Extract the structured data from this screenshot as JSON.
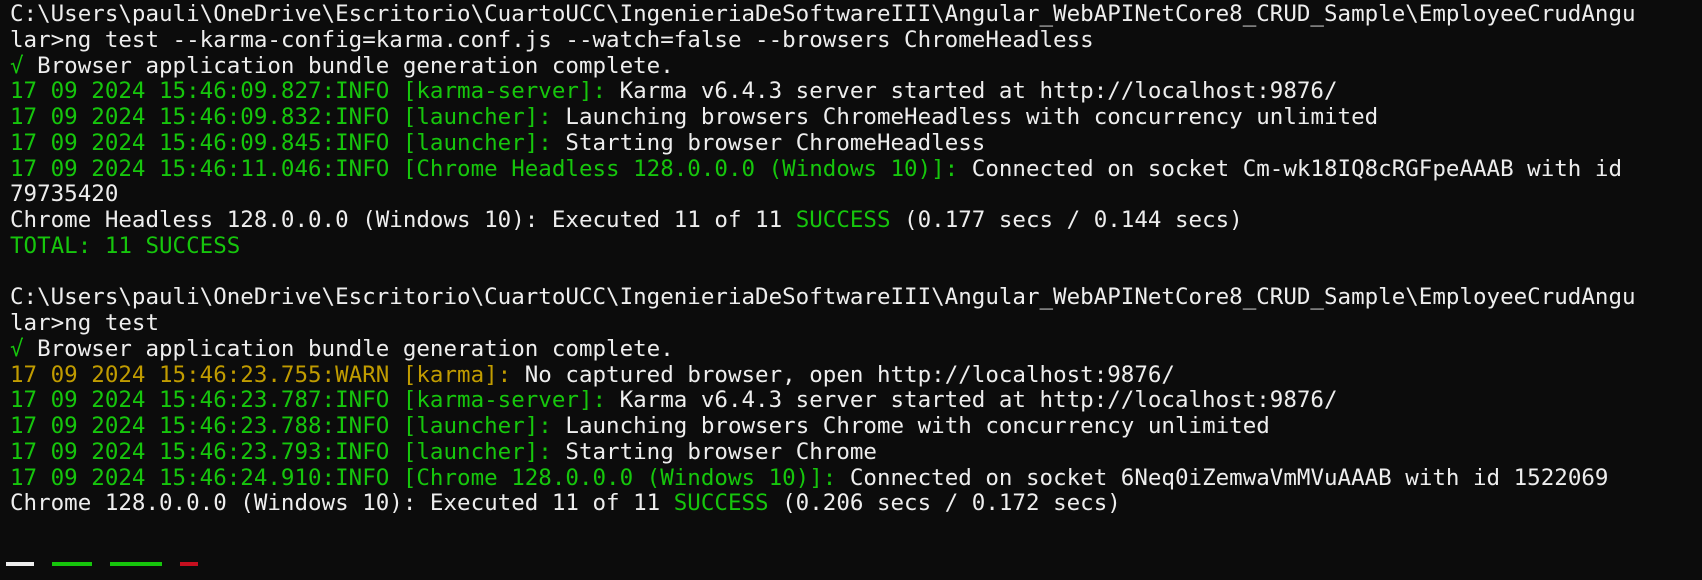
{
  "colors": {
    "background": "#0c0c0c",
    "default_text": "#eeeeee",
    "green": "#16c60c",
    "yellow": "#c19c00"
  },
  "lines": [
    [
      {
        "t": "C:\\Users\\pauli\\OneDrive\\Escritorio\\CuartoUCC\\IngenieriaDeSoftwareIII\\Angular_WebAPINetCore8_CRUD_Sample\\EmployeeCrudAngu",
        "c": "white"
      }
    ],
    [
      {
        "t": "lar>ng test --karma-config=karma.conf.js --watch=false --browsers ChromeHeadless",
        "c": "white"
      }
    ],
    [
      {
        "t": "√",
        "c": "green"
      },
      {
        "t": " Browser application bundle generation complete.",
        "c": "white"
      }
    ],
    [
      {
        "t": "17 09 2024 15:46:09.827:INFO [karma-server]: ",
        "c": "green"
      },
      {
        "t": "Karma v6.4.3 server started at http://localhost:9876/",
        "c": "white"
      }
    ],
    [
      {
        "t": "17 09 2024 15:46:09.832:INFO [launcher]: ",
        "c": "green"
      },
      {
        "t": "Launching browsers ChromeHeadless with concurrency unlimited",
        "c": "white"
      }
    ],
    [
      {
        "t": "17 09 2024 15:46:09.845:INFO [launcher]: ",
        "c": "green"
      },
      {
        "t": "Starting browser ChromeHeadless",
        "c": "white"
      }
    ],
    [
      {
        "t": "17 09 2024 15:46:11.046:INFO [Chrome Headless 128.0.0.0 (Windows 10)]: ",
        "c": "green"
      },
      {
        "t": "Connected on socket Cm-wk18IQ8cRGFpeAAAB with id",
        "c": "white"
      }
    ],
    [
      {
        "t": "79735420",
        "c": "white"
      }
    ],
    [
      {
        "t": "Chrome Headless 128.0.0.0 (Windows 10): Executed 11 of 11 ",
        "c": "white"
      },
      {
        "t": "SUCCESS",
        "c": "green"
      },
      {
        "t": " (0.177 secs / 0.144 secs)",
        "c": "white"
      }
    ],
    [
      {
        "t": "TOTAL: 11 SUCCESS",
        "c": "green"
      }
    ],
    [
      {
        "t": "",
        "c": "white"
      }
    ],
    [
      {
        "t": "C:\\Users\\pauli\\OneDrive\\Escritorio\\CuartoUCC\\IngenieriaDeSoftwareIII\\Angular_WebAPINetCore8_CRUD_Sample\\EmployeeCrudAngu",
        "c": "white"
      }
    ],
    [
      {
        "t": "lar>ng test",
        "c": "white"
      }
    ],
    [
      {
        "t": "√",
        "c": "green"
      },
      {
        "t": " Browser application bundle generation complete.",
        "c": "white"
      }
    ],
    [
      {
        "t": "17 09 2024 15:46:23.755:WARN [karma]: ",
        "c": "yellow"
      },
      {
        "t": "No captured browser, open http://localhost:9876/",
        "c": "white"
      }
    ],
    [
      {
        "t": "17 09 2024 15:46:23.787:INFO [karma-server]: ",
        "c": "green"
      },
      {
        "t": "Karma v6.4.3 server started at http://localhost:9876/",
        "c": "white"
      }
    ],
    [
      {
        "t": "17 09 2024 15:46:23.788:INFO [launcher]: ",
        "c": "green"
      },
      {
        "t": "Launching browsers Chrome with concurrency unlimited",
        "c": "white"
      }
    ],
    [
      {
        "t": "17 09 2024 15:46:23.793:INFO [launcher]: ",
        "c": "green"
      },
      {
        "t": "Starting browser Chrome",
        "c": "white"
      }
    ],
    [
      {
        "t": "17 09 2024 15:46:24.910:INFO [Chrome 128.0.0.0 (Windows 10)]: ",
        "c": "green"
      },
      {
        "t": "Connected on socket 6Neq0iZemwaVmMVuAAAB with id 1522069",
        "c": "white"
      }
    ],
    [
      {
        "t": "Chrome 128.0.0.0 (Windows 10): Executed 11 of 11 ",
        "c": "white"
      },
      {
        "t": "SUCCESS",
        "c": "green"
      },
      {
        "t": " (0.206 secs / 0.172 secs)",
        "c": "white"
      }
    ]
  ]
}
